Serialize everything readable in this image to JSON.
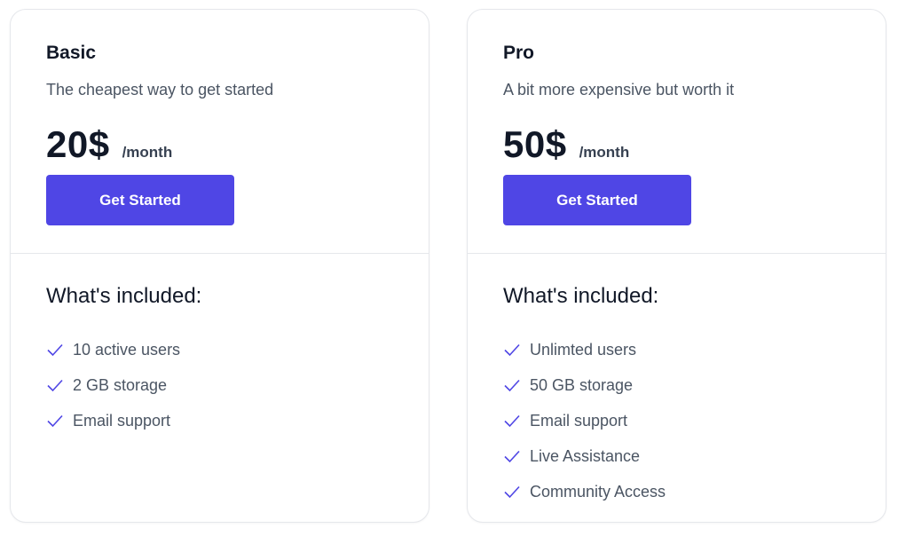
{
  "colors": {
    "accent": "#4f46e5",
    "check": "#4f46e5",
    "border": "#e5e7eb"
  },
  "plans": [
    {
      "name": "Basic",
      "description": "The cheapest way to get started",
      "price": "20$",
      "period": "/month",
      "cta": "Get Started",
      "included_title": "What's included:",
      "features": [
        "10 active users",
        "2 GB storage",
        "Email support"
      ]
    },
    {
      "name": "Pro",
      "description": "A bit more expensive but worth it",
      "price": "50$",
      "period": "/month",
      "cta": "Get Started",
      "included_title": "What's included:",
      "features": [
        "Unlimted users",
        "50 GB storage",
        "Email support",
        "Live Assistance",
        "Community Access"
      ]
    }
  ]
}
